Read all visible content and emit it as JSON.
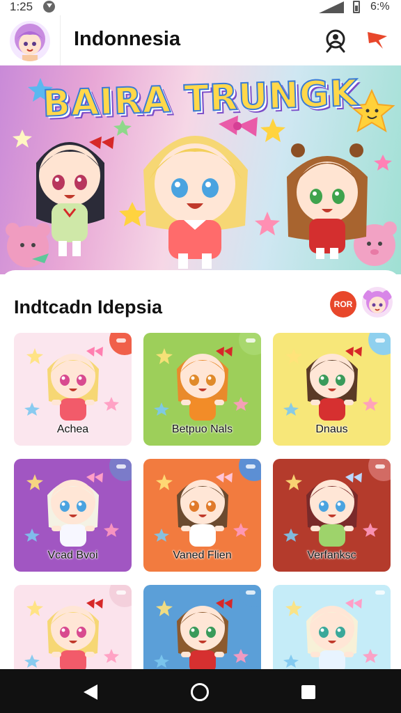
{
  "status_bar": {
    "time": "1:25",
    "battery_text": "6:%",
    "icons": [
      "download-icon",
      "signal-icon",
      "battery-icon"
    ]
  },
  "app_bar": {
    "title": "Indonnesia",
    "icons": [
      "avatar",
      "search-person-icon",
      "share-icon"
    ]
  },
  "hero": {
    "title": "BAIRA TRUNGK"
  },
  "section": {
    "title": "Indtcadn Idepsia",
    "badge_text": "ROR"
  },
  "tiles": [
    {
      "label": "Achea",
      "bg": "#fbe6ee",
      "corner": "#f0604a"
    },
    {
      "label": "Betpuo Nals",
      "bg": "#9dcf5a",
      "corner": "#a8d86e"
    },
    {
      "label": "Dnaus",
      "bg": "#f7e779",
      "corner": "#8fd0ee"
    },
    {
      "label": "Vcad Bvoi",
      "bg": "#a156c2",
      "corner": "#7b7bc9"
    },
    {
      "label": "Vaned Flien",
      "bg": "#f27b3f",
      "corner": "#5c8fd4"
    },
    {
      "label": "Verfanksc",
      "bg": "#b43b2c",
      "corner": "#d26b64"
    },
    {
      "label": "",
      "bg": "#fbe3ec",
      "corner": "#f4d0dc"
    },
    {
      "label": "",
      "bg": "#5b9fd8",
      "corner": "#5b9fd8"
    },
    {
      "label": "",
      "bg": "#c5ecf8",
      "corner": "#c5ecf8"
    }
  ],
  "colors": {
    "accent": "#e8472b",
    "nav_bar": "#111111"
  }
}
